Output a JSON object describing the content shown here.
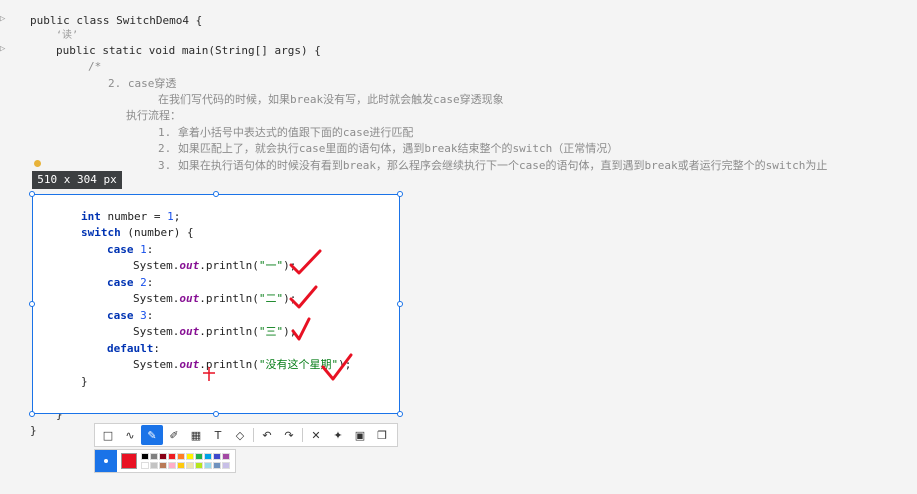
{
  "editor": {
    "line_class": "public class SwitchDemo4 {",
    "hint_usages": "‘读’",
    "line_main": "public static void main(String[] args) {",
    "comment_open": "/*",
    "comment_lines": [
      "2. case穿透",
      "在我们写代码的时候，如果break没有写，此时就会触发case穿透现象",
      "执行流程：",
      "1. 拿着小括号中表达式的值跟下面的case进行匹配",
      "2. 如果匹配上了，就会执行case里面的语句体，遇到break结束整个的switch（正常情况）",
      "3. 如果在执行语句体的时候没有看到break，那么程序会继续执行下一个case的语句体，直到遇到break或者运行完整个的switch为止"
    ],
    "close_inner": "}",
    "close_outer": "}"
  },
  "capture": {
    "size_label": "510 x 304 px",
    "code": {
      "l1_kw": "int",
      "l1_rest": " number = ",
      "l1_num": "1",
      "l1_end": ";",
      "l2_kw": "switch",
      "l2_rest": " (number) {",
      "case1_kw": "case",
      "case1_num": " 1",
      "case1_end": ":",
      "p1_a": "System.",
      "p1_fld": "out",
      "p1_b": ".println(",
      "p1_str": "\"一\"",
      "p1_end": ");",
      "case2_kw": "case",
      "case2_num": " 2",
      "case2_end": ":",
      "p2_a": "System.",
      "p2_fld": "out",
      "p2_b": ".println(",
      "p2_str": "\"二\"",
      "p2_end": ");",
      "case3_kw": "case",
      "case3_num": " 3",
      "case3_end": ":",
      "p3_a": "System.",
      "p3_fld": "out",
      "p3_b": ".println(",
      "p3_str": "\"三\"",
      "p3_end": ");",
      "default_kw": "default",
      "default_end": ":",
      "p4_a": "System.",
      "p4_fld": "out",
      "p4_b": ".println(",
      "p4_str": "\"没有这个星期\"",
      "p4_end": ");",
      "close": "}"
    }
  },
  "toolbar": {
    "tools": [
      {
        "name": "rectangle-tool-icon",
        "glyph": "□"
      },
      {
        "name": "polyline-tool-icon",
        "glyph": "∿"
      },
      {
        "name": "pen-tool-icon",
        "glyph": "✎",
        "active": true
      },
      {
        "name": "highlighter-tool-icon",
        "glyph": "✐"
      },
      {
        "name": "mosaic-tool-icon",
        "glyph": "▦"
      },
      {
        "name": "text-tool-icon",
        "glyph": "T"
      },
      {
        "name": "eraser-tool-icon",
        "glyph": "◇"
      },
      {
        "name": "undo-icon",
        "glyph": "↶"
      },
      {
        "name": "redo-icon",
        "glyph": "↷"
      },
      {
        "name": "close-icon",
        "glyph": "✕"
      },
      {
        "name": "pin-icon",
        "glyph": "✦"
      },
      {
        "name": "save-icon",
        "glyph": "▣"
      },
      {
        "name": "copy-icon",
        "glyph": "❐"
      }
    ]
  },
  "palette": {
    "current": "#e81123",
    "row1": [
      "#000000",
      "#7f7f7f",
      "#880015",
      "#ed1c24",
      "#ff7f27",
      "#fff200",
      "#22b14c",
      "#00a2e8",
      "#3f48cc",
      "#a349a4"
    ],
    "row2": [
      "#ffffff",
      "#c3c3c3",
      "#b97a57",
      "#ffaec9",
      "#ffc90e",
      "#efe4b0",
      "#b5e61d",
      "#99d9ea",
      "#7092be",
      "#c8bfe7"
    ]
  },
  "colors": {
    "selection": "#1a73e8",
    "annotation": "#e81123"
  }
}
